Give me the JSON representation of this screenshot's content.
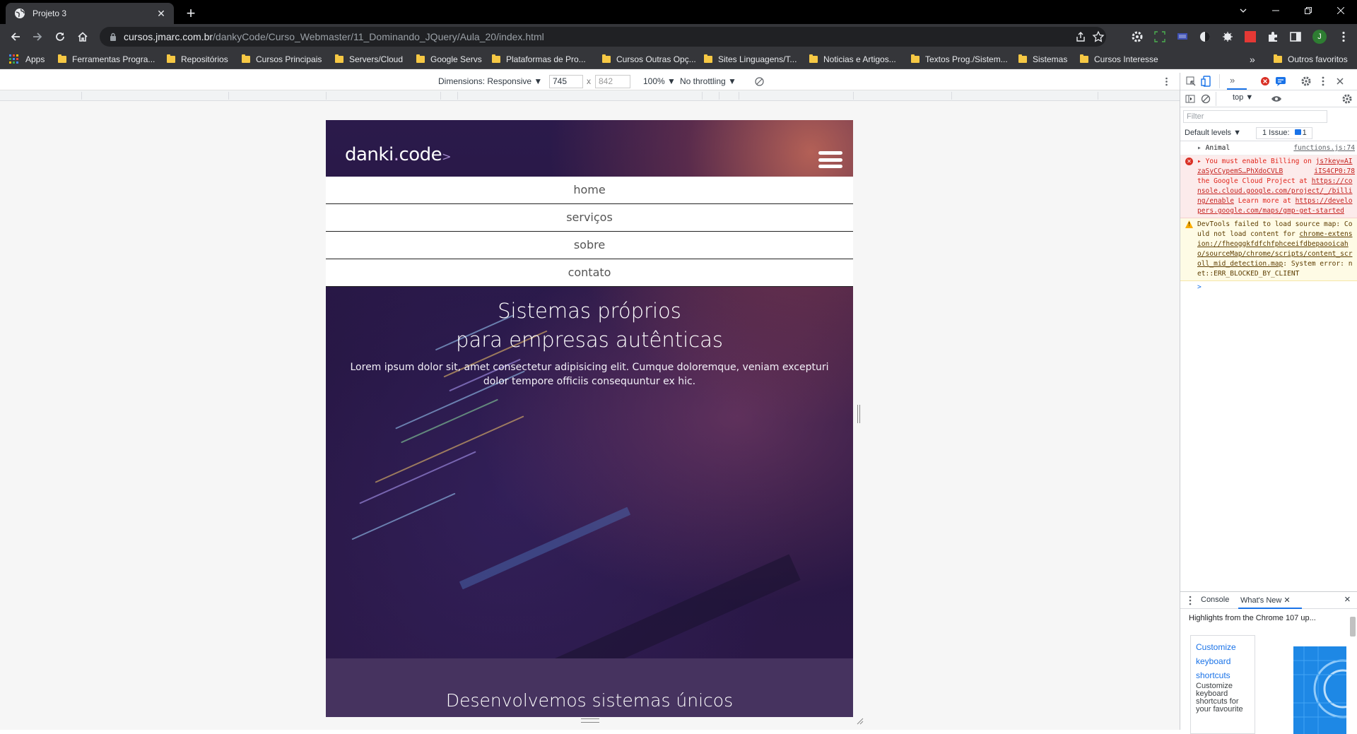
{
  "browser": {
    "tab_title": "Projeto 3",
    "url_host": "cursos.jmarc.com.br",
    "url_path": "/dankyCode/Curso_Webmaster/11_Dominando_JQuery/Aula_20/index.html",
    "profile_initial": "J"
  },
  "bookmarks": {
    "apps": "Apps",
    "items": [
      "Ferramentas Progra...",
      "Repositórios",
      "Cursos Principais",
      "Servers/Cloud",
      "Google Servs",
      "Plataformas de Pro...",
      "Cursos Outras Opç...",
      "Sites Linguagens/T...",
      "Noticias e Artigos...",
      "Textos Prog./Sistem...",
      "Sistemas",
      "Cursos Interesse"
    ],
    "more": "»",
    "others": "Outros favoritos"
  },
  "device_toolbar": {
    "dimensions_label": "Dimensions: Responsive ▼",
    "width": "745",
    "times": "x",
    "height": "842",
    "zoom": "100% ▼",
    "throttling": "No throttling ▼"
  },
  "site": {
    "logo_main": "danki",
    "logo_dot": ".",
    "logo_tail": "code",
    "logo_chevron": ">",
    "nav": [
      "home",
      "serviços",
      "sobre",
      "contato"
    ],
    "hero_title_1": "Sistemas próprios",
    "hero_title_2": "para empresas autênticas",
    "hero_text": "Lorem ipsum dolor sit, amet consectetur adipisicing elit. Cumque doloremque, veniam excepturi dolor tempore officiis consequuntur ex hic.",
    "section2_title": "Desenvolvemos sistemas únicos"
  },
  "devtools": {
    "context": "top ▼",
    "filter_placeholder": "Filter",
    "levels": "Default levels ▼",
    "issues": "1 Issue:",
    "issues_count": "1",
    "log1_text": "Animal",
    "log1_src": "functions.js:74",
    "err_prefix": "You must enable Billing on",
    "err_link1": "js?key=AIzaSyCCypemS…PhXdoCVLB",
    "err_link1b": "iIS4CP0:78",
    "err_text2": "the Google Cloud Project at",
    "err_link2": "https://console.cloud.google.com/project/_/billing/enable",
    "err_text3": "Learn more at",
    "err_link3": "https://developers.google.com/maps/gmp-get-started",
    "warn_text1": "DevTools failed to load source map: Could not load content for",
    "warn_link": "chrome-extension://fheoggkfdfchfphceeifdbepaooicaho/sourceMap/chrome/scripts/content_scroll_mid_detection.map",
    "warn_text2": ": System error: net::ERR_BLOCKED_BY_CLIENT",
    "prompt": ">",
    "drawer_tab1": "Console",
    "drawer_tab2": "What's New",
    "drawer_close": "×",
    "whatsnew_heading": "Highlights from the Chrome 107 up...",
    "card_title_1": "Customize",
    "card_title_2": "keyboard",
    "card_title_3": "shortcuts",
    "card_body": "Customize keyboard shortcuts for your favourite"
  },
  "colors": {
    "chrome_dark": "#35363a",
    "hero_purple": "#2a1a48",
    "section2_bg": "#46335f",
    "error_red": "#e1251b"
  }
}
